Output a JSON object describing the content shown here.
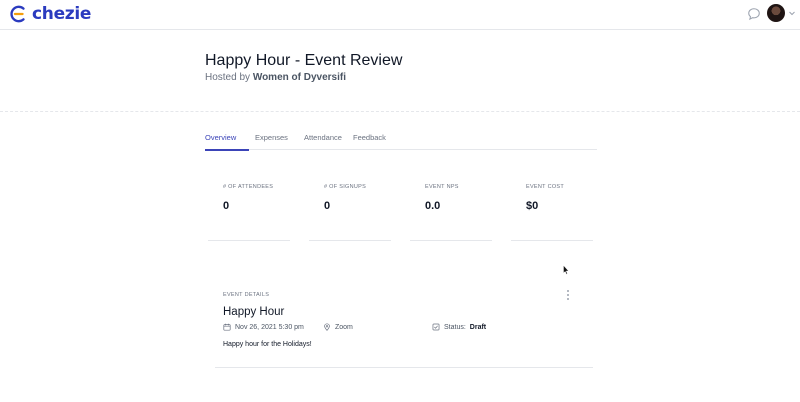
{
  "brand": {
    "name": "chezie",
    "accent": "#3b44b8"
  },
  "header": {
    "title": "Happy Hour - Event Review",
    "hosted_prefix": "Hosted by",
    "host": "Women of Dyversifi"
  },
  "tabs": [
    {
      "label": "Overview",
      "active": true
    },
    {
      "label": "Expenses",
      "active": false
    },
    {
      "label": "Attendance",
      "active": false
    },
    {
      "label": "Feedback",
      "active": false
    }
  ],
  "stats": [
    {
      "label": "# OF ATTENDEES",
      "value": "0"
    },
    {
      "label": "# OF SIGNUPS",
      "value": "0"
    },
    {
      "label": "EVENT NPS",
      "value": "0.0"
    },
    {
      "label": "EVENT COST",
      "value": "$0"
    }
  ],
  "event": {
    "section_label": "EVENT DETAILS",
    "name": "Happy Hour",
    "datetime": "Nov 26, 2021 5:30 pm",
    "location": "Zoom",
    "status_label": "Status:",
    "status_value": "Draft",
    "description": "Happy hour for the Holidays!"
  },
  "icons": {
    "chat": "chat-bubble-icon",
    "calendar": "calendar-icon",
    "location": "map-pin-icon",
    "status": "checkbox-icon",
    "menu": "kebab-menu-icon"
  }
}
